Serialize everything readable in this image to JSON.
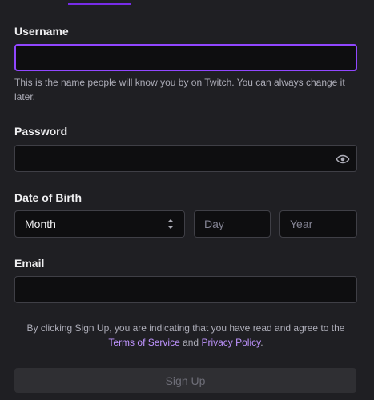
{
  "form": {
    "username": {
      "label": "Username",
      "value": "",
      "hint": "This is the name people will know you by on Twitch. You can always change it later."
    },
    "password": {
      "label": "Password",
      "value": "",
      "toggle_icon": "eye-icon"
    },
    "dob": {
      "label": "Date of Birth",
      "month_value": "Month",
      "day_placeholder": "Day",
      "year_placeholder": "Year"
    },
    "email": {
      "label": "Email",
      "value": ""
    },
    "terms": {
      "before": "By clicking Sign Up, you are indicating that you have read and agree to the ",
      "tos_link": "Terms of Service",
      "and": " and ",
      "privacy_link": "Privacy Policy",
      "end": "."
    },
    "signup_label": "Sign Up"
  },
  "colors": {
    "background": "#1f1f23",
    "input_bg": "#0e0e10",
    "accent": "#9147ff",
    "link": "#bf94ff"
  }
}
